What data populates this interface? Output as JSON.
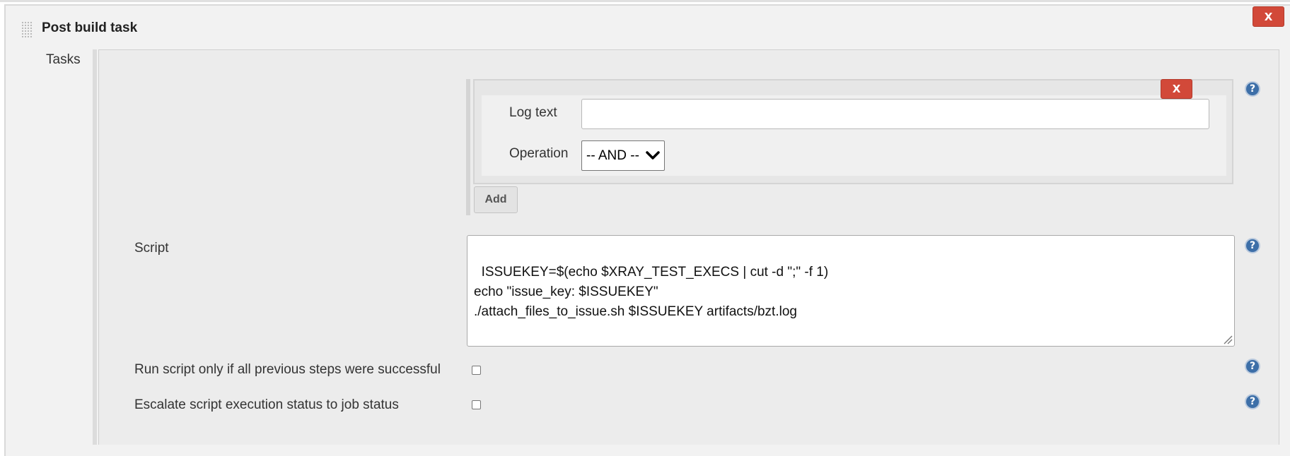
{
  "section": {
    "title": "Post build task",
    "delete_label": "X"
  },
  "tasks": {
    "label": "Tasks",
    "condition": {
      "delete_label": "X",
      "log_text_label": "Log text",
      "log_text_value": "",
      "operation_label": "Operation",
      "operation_selected": "-- AND --"
    },
    "add_label": "Add",
    "script_label": "Script",
    "script_value": "ISSUEKEY=$(echo $XRAY_TEST_EXECS | cut -d \";\" -f 1)\necho \"issue_key: $ISSUEKEY\"\n./attach_files_to_issue.sh $ISSUEKEY artifacts/bzt.log",
    "run_only_if_success_label": "Run script only if all previous steps were successful",
    "escalate_status_label": "Escalate script execution status to job status",
    "help_icon_glyph": "?"
  },
  "colors": {
    "delete_button": "#d24939",
    "help_icon": "#3d6fa8",
    "panel_background": "#f2f2f2"
  },
  "icons": [
    "drag-handle-icon",
    "chevron-down-icon",
    "help-icon",
    "resize-grip-icon"
  ]
}
